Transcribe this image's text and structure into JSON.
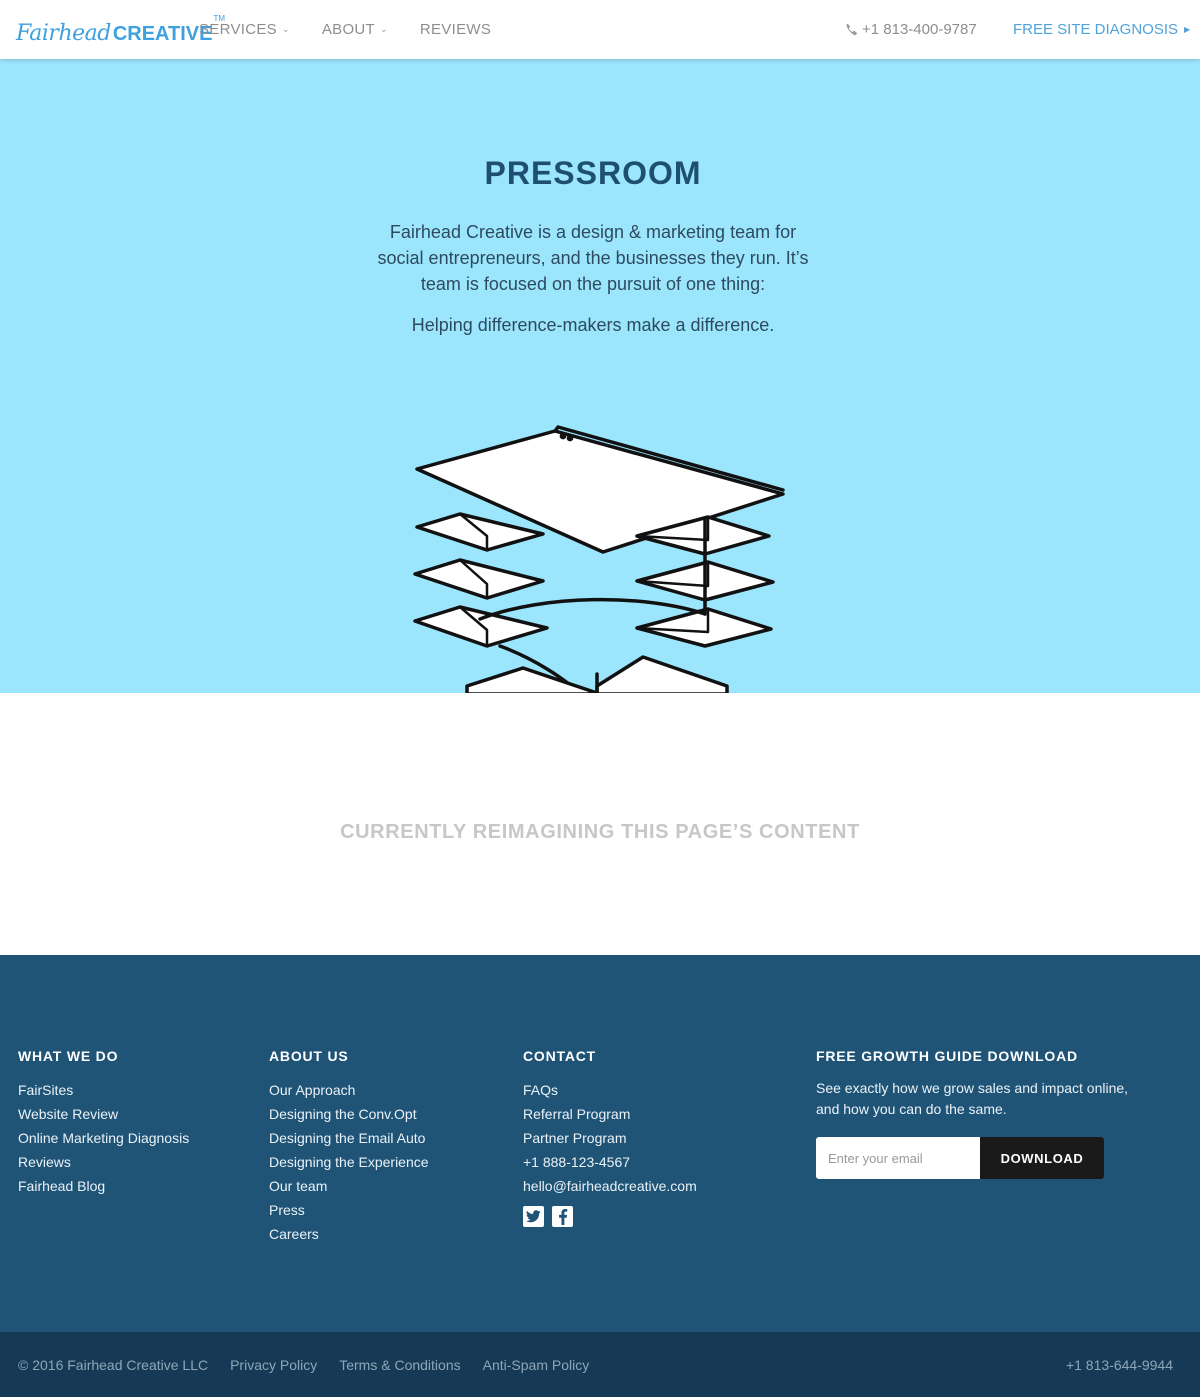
{
  "header": {
    "logo": {
      "script": "Fairhead",
      "bold": "CREATIVE",
      "tm": "TM"
    },
    "nav": [
      {
        "label": "SERVICES",
        "has_dropdown": true
      },
      {
        "label": "ABOUT",
        "has_dropdown": true
      },
      {
        "label": "REVIEWS",
        "has_dropdown": false
      }
    ],
    "phone": "+1 813-400-9787",
    "cta": "FREE SITE DIAGNOSIS"
  },
  "hero": {
    "title": "PRESSROOM",
    "text": "Fairhead Creative is a design & marketing team for social entrepreneurs, and the businesses they run. It’s team is focused on the pursuit of one thing:",
    "tagline": "Helping difference-makers make a difference.",
    "background": "#9ce6fd"
  },
  "content": {
    "message": "CURRENTLY REIMAGINING THIS PAGE’S CONTENT"
  },
  "footer": {
    "what_we_do": {
      "heading": "WHAT WE DO",
      "links": [
        "FairSites",
        "Website Review",
        "Online Marketing Diagnosis",
        "Reviews",
        "Fairhead Blog"
      ]
    },
    "about_us": {
      "heading": "ABOUT US",
      "links": [
        "Our Approach",
        "Designing the Conv.Opt",
        "Designing the Email Auto",
        "Designing the Experience",
        "Our team",
        "Press",
        "Careers"
      ]
    },
    "contact": {
      "heading": "CONTACT",
      "links": [
        "FAQs",
        "Referral Program",
        "Partner Program",
        "+1 888-123-4567",
        "hello@fairheadcreative.com"
      ],
      "social": [
        "twitter-icon",
        "facebook-icon"
      ]
    },
    "guide": {
      "heading": "FREE GROWTH GUIDE DOWNLOAD",
      "text": "See exactly how we grow sales and impact online, and how you can do the same.",
      "email_placeholder": "Enter your email",
      "button": "DOWNLOAD"
    },
    "background": "#1f5477"
  },
  "bottom_bar": {
    "copyright": "© 2016 Fairhead Creative LLC",
    "links": [
      "Privacy Policy",
      "Terms & Conditions",
      "Anti-Spam Policy"
    ],
    "phone": "+1 813-644-9944"
  }
}
